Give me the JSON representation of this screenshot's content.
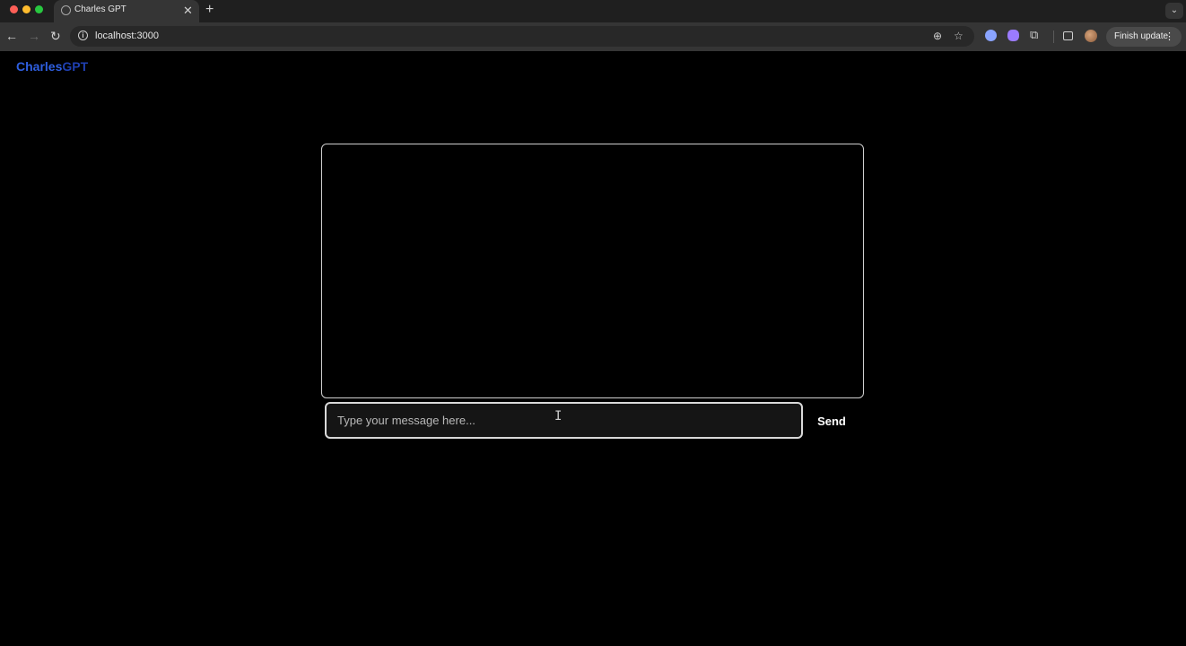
{
  "browser": {
    "tab_title": "Charles GPT",
    "tab_close": "✕",
    "new_tab": "+",
    "tab_dropdown": "⌄",
    "url": "localhost:3000",
    "finish_update_label": "Finish update",
    "nav_back": "←",
    "nav_forward": "→",
    "nav_reload": "↻",
    "zoom": "⊕",
    "star": "☆",
    "puzzle": "⧉",
    "kebab": "⋮",
    "info": "i"
  },
  "app": {
    "brand_part1": "Charles",
    "brand_part2": "GPT"
  },
  "chat": {
    "input_placeholder": "Type your message here...",
    "input_value": "",
    "send_label": "Send",
    "text_cursor": "I"
  },
  "colors": {
    "background": "#000000",
    "brand_primary": "#2f5fe0",
    "brand_secondary": "#1f3fb0"
  }
}
